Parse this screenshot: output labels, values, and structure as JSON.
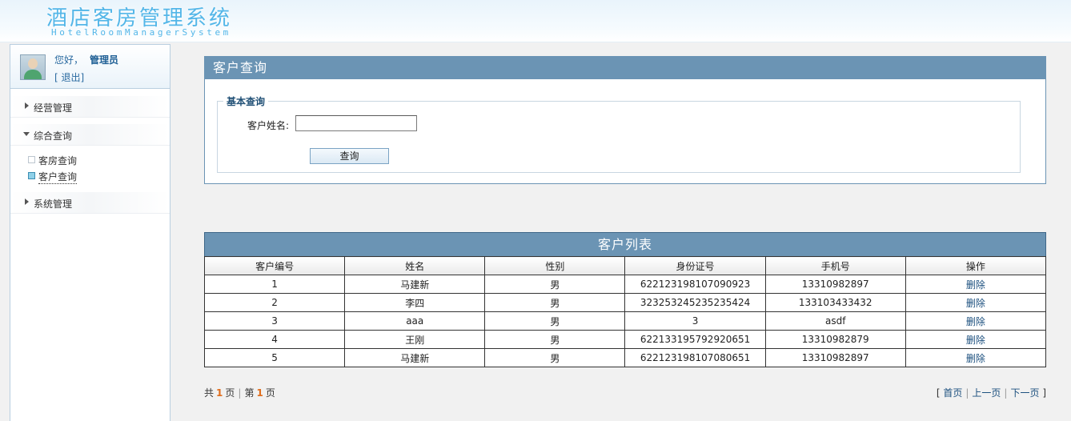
{
  "header": {
    "title": "酒店客房管理系统",
    "subtitle": "HotelRoomManagerSystem"
  },
  "user": {
    "greeting": "您好，",
    "name": "管理员",
    "logout": "[ 退出]"
  },
  "sidebar": {
    "groups": [
      {
        "label": "经营管理"
      },
      {
        "label": "综合查询"
      },
      {
        "label": "系统管理"
      }
    ],
    "sub_items": [
      {
        "label": "客房查询"
      },
      {
        "label": "客户查询"
      }
    ]
  },
  "query": {
    "panel_title": "客户查询",
    "fieldset_title": "基本查询",
    "field_label": "客户姓名:",
    "field_value": "",
    "button_label": "查询"
  },
  "list": {
    "title": "客户列表",
    "columns": [
      "客户编号",
      "姓名",
      "性别",
      "身份证号",
      "手机号",
      "操作"
    ],
    "rows": [
      [
        "1",
        "马建新",
        "男",
        "622123198107090923",
        "13310982897",
        "删除"
      ],
      [
        "2",
        "李四",
        "男",
        "323253245235235424",
        "133103433432",
        "删除"
      ],
      [
        "3",
        "aaa",
        "男",
        "3",
        "asdf",
        "删除"
      ],
      [
        "4",
        "王刚",
        "男",
        "622133195792920651",
        "13310982879",
        "删除"
      ],
      [
        "5",
        "马建新",
        "男",
        "622123198107080651",
        "13310982897",
        "删除"
      ]
    ]
  },
  "pagination": {
    "total_prefix": "共",
    "total_pages": "1",
    "total_suffix": "页",
    "current_prefix": "第",
    "current_page": "1",
    "current_suffix": "页",
    "first": "首页",
    "prev": "上一页",
    "next": "下一页",
    "open_bracket": "[",
    "close_bracket": "]"
  },
  "colors": {
    "panel_header": "#6b94b4",
    "title_blue": "#53b6e8",
    "page_number": "#e06d1c"
  }
}
